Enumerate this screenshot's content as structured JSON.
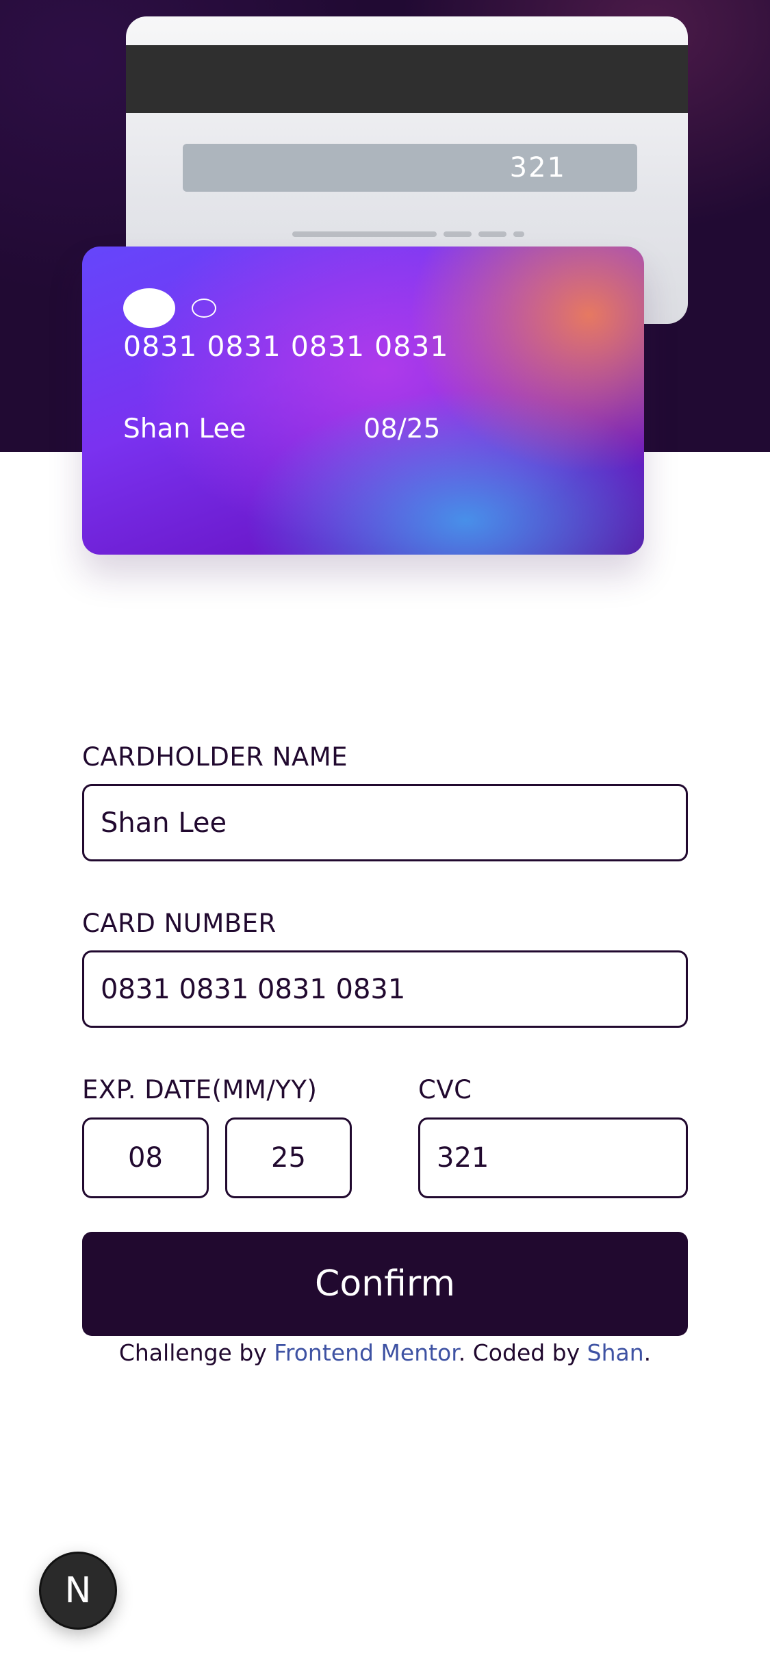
{
  "card_back": {
    "cvc": "321"
  },
  "card_front": {
    "number": "0831 0831 0831 0831",
    "name": "Shan Lee",
    "expiry": "08/25"
  },
  "form": {
    "cardholder_label": "CARDHOLDER NAME",
    "cardholder_value": "Shan Lee",
    "number_label": "CARD NUMBER",
    "number_value": "0831 0831 0831 0831",
    "exp_label": "EXP. DATE(MM/YY)",
    "exp_month": "08",
    "exp_year": "25",
    "cvc_label": "CVC",
    "cvc_value": "321",
    "confirm_label": "Confirm"
  },
  "attribution": {
    "prefix": "Challenge by ",
    "mentor_link": "Frontend Mentor",
    "middle": ". Coded by ",
    "author_link": "Shan",
    "suffix": "."
  },
  "badge": {
    "letter": "N"
  },
  "colors": {
    "dark_violet": "#21092f",
    "link": "#3e52a3"
  }
}
